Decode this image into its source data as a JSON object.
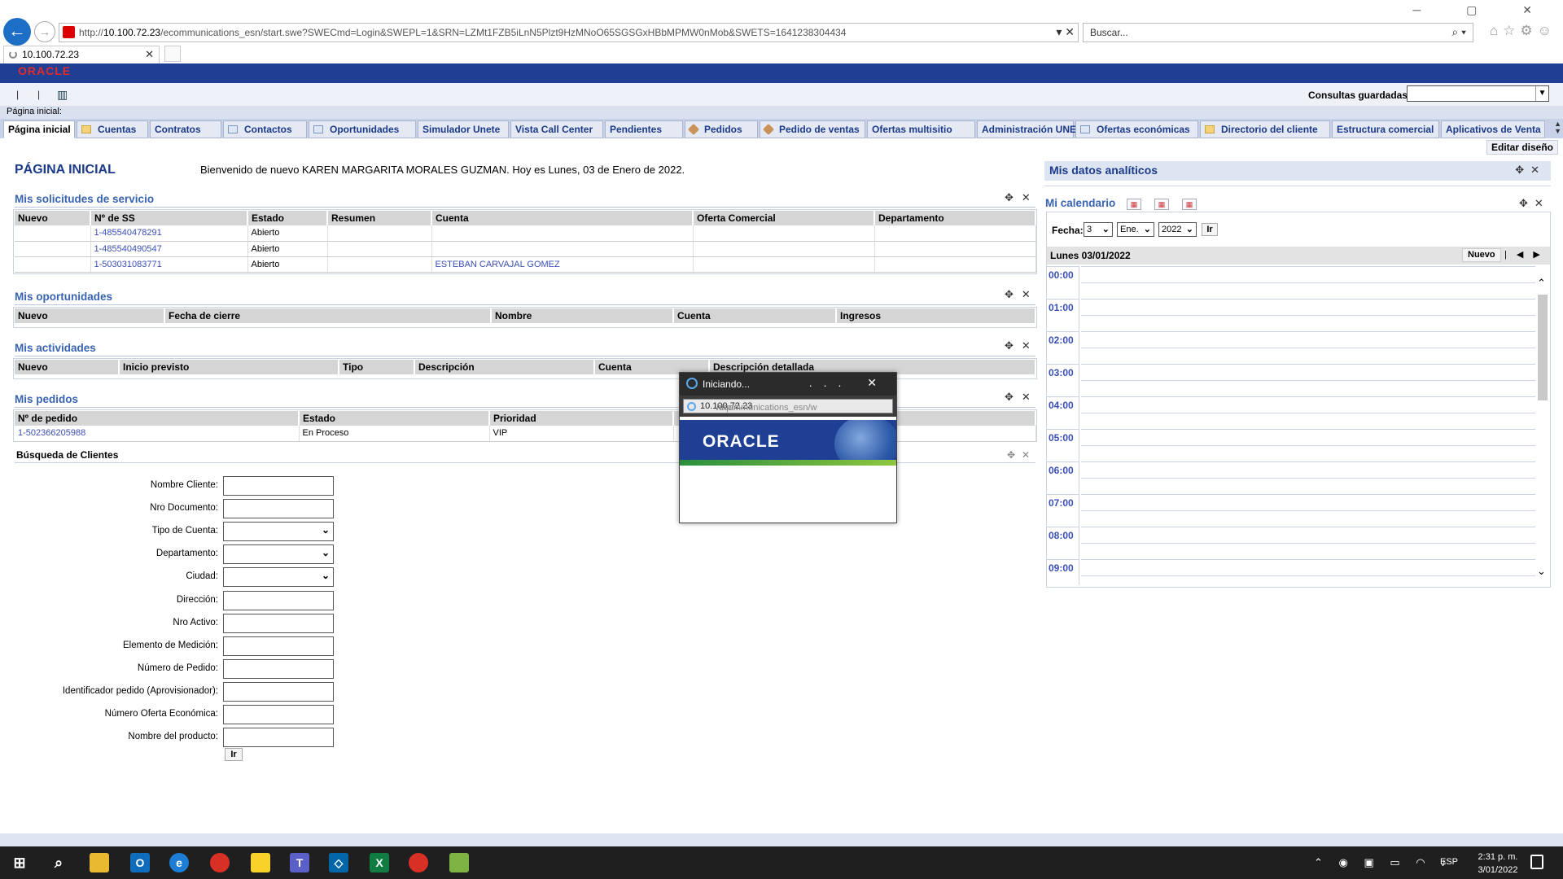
{
  "browser": {
    "url_prefix": "http://",
    "url_host": "10.100.72.23",
    "url_rest": "/ecommunications_esn/start.swe?SWECmd=Login&SWEPL=1&SRN=LZMt1FZB5iLnN5Plzt9HzMNoO65SGSGxHBbMPMW0nMob&SWETS=1641238304434",
    "search_placeholder": "Buscar...",
    "tab_title": "10.100.72.23"
  },
  "app": {
    "logo": "ORACLE",
    "saved_queries_label": "Consultas guardadas:",
    "breadcrumb": "Página inicial:",
    "edit_design": "Editar diseño"
  },
  "tabs": [
    {
      "label": "Página inicial",
      "icon": ""
    },
    {
      "label": "Cuentas",
      "icon": "folder"
    },
    {
      "label": "Contratos",
      "icon": ""
    },
    {
      "label": "Contactos",
      "icon": "doc"
    },
    {
      "label": "Oportunidades",
      "icon": "doc"
    },
    {
      "label": "Simulador Unete",
      "icon": ""
    },
    {
      "label": "Vista Call Center",
      "icon": ""
    },
    {
      "label": "Pendientes",
      "icon": ""
    },
    {
      "label": "Pedidos",
      "icon": "tool"
    },
    {
      "label": "Pedido de ventas",
      "icon": "tool"
    },
    {
      "label": "Ofertas multisitio",
      "icon": ""
    },
    {
      "label": "Administración UNE",
      "icon": ""
    },
    {
      "label": "Ofertas económicas",
      "icon": "doc"
    },
    {
      "label": "Directorio del cliente",
      "icon": "folder"
    },
    {
      "label": "Estructura comercial",
      "icon": ""
    },
    {
      "label": "Aplicativos de Venta",
      "icon": ""
    }
  ],
  "home": {
    "title": "PÁGINA INICIAL",
    "welcome": "Bienvenido de nuevo KAREN MARGARITA MORALES GUZMAN.  Hoy es Lunes, 03 de Enero de 2022."
  },
  "service_requests": {
    "title": "Mis solicitudes de servicio",
    "columns": [
      "Nuevo",
      "Nº de SS",
      "Estado",
      "Resumen",
      "Cuenta",
      "Oferta Comercial",
      "Departamento"
    ],
    "rows": [
      {
        "new": "",
        "ss": "1-485540478291",
        "status": "Abierto",
        "summary": "",
        "account": "",
        "offer": "",
        "dept": ""
      },
      {
        "new": "",
        "ss": "1-485540490547",
        "status": "Abierto",
        "summary": "",
        "account": "",
        "offer": "",
        "dept": ""
      },
      {
        "new": "",
        "ss": "1-503031083771",
        "status": "Abierto",
        "summary": "",
        "account": "ESTEBAN CARVAJAL GOMEZ",
        "offer": "",
        "dept": ""
      }
    ]
  },
  "opportunities": {
    "title": "Mis oportunidades",
    "columns": [
      "Nuevo",
      "Fecha de cierre",
      "Nombre",
      "Cuenta",
      "Ingresos"
    ]
  },
  "activities": {
    "title": "Mis actividades",
    "columns": [
      "Nuevo",
      "Inicio previsto",
      "Tipo",
      "Descripción",
      "Cuenta",
      "Descripción detallada"
    ]
  },
  "orders": {
    "title": "Mis pedidos",
    "columns": [
      "Nº de pedido",
      "Estado",
      "Prioridad",
      ""
    ],
    "rows": [
      {
        "order": "1-502366205988",
        "status": "En Proceso",
        "priority": "VIP",
        "extra": ""
      }
    ]
  },
  "customer_search": {
    "title": "Búsqueda de Clientes",
    "fields": [
      {
        "label": "Nombre Cliente:",
        "type": "text"
      },
      {
        "label": "Nro Documento:",
        "type": "text"
      },
      {
        "label": "Tipo de Cuenta:",
        "type": "select"
      },
      {
        "label": "Departamento:",
        "type": "select"
      },
      {
        "label": "Ciudad:",
        "type": "select"
      },
      {
        "label": "Dirección:",
        "type": "text"
      },
      {
        "label": "Nro Activo:",
        "type": "text"
      },
      {
        "label": "Elemento de Medición:",
        "type": "text"
      },
      {
        "label": "Número de Pedido:",
        "type": "text"
      },
      {
        "label": "Identificador pedido (Aprovisionador):",
        "type": "text"
      },
      {
        "label": "Número Oferta Económica:",
        "type": "text"
      },
      {
        "label": "Nombre del producto:",
        "type": "text"
      }
    ],
    "go": "Ir"
  },
  "analytics": {
    "title": "Mis datos analíticos"
  },
  "calendar": {
    "title": "Mi calendario",
    "date_label": "Fecha:",
    "day": "3",
    "month": "Ene.",
    "year": "2022",
    "go": "Ir",
    "header": "Lunes 03/01/2022",
    "new": "Nuevo",
    "hours": [
      "00:00",
      "01:00",
      "02:00",
      "03:00",
      "04:00",
      "05:00",
      "06:00",
      "07:00",
      "08:00",
      "09:00"
    ]
  },
  "popup": {
    "title": "Iniciando...",
    "dots": "...",
    "url_prefix": "http://",
    "url_host": "10.100.72.23",
    "url_rest": "/ecommunications_esn/w",
    "logo": "ORACLE"
  },
  "taskbar": {
    "lang": "ESP",
    "time": "2:31 p. m.",
    "date": "3/01/2022"
  },
  "colors": {
    "oracle_blue": "#1e3f94",
    "link": "#3a4fb5",
    "section_title": "#3763b0"
  }
}
